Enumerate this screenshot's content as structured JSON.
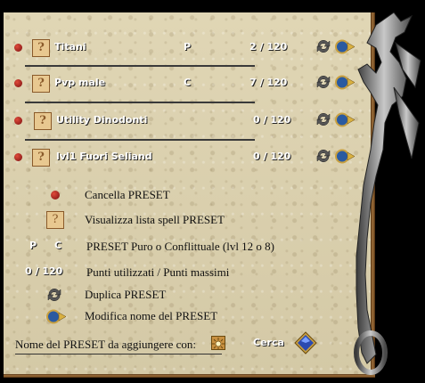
{
  "presets": [
    {
      "name": "Titani",
      "type": "P",
      "used": "2",
      "max": "120"
    },
    {
      "name": "Pvp male",
      "type": "C",
      "used": "7",
      "max": "120"
    },
    {
      "name": "Utility Dinodonti",
      "type": "",
      "used": "0",
      "max": "120"
    },
    {
      "name": "lvl1 Fuori Seliand",
      "type": "",
      "used": "0",
      "max": "120"
    }
  ],
  "legend": {
    "delete_label": "Cancella PRESET",
    "view_label": "Visualizza lista spell PRESET",
    "p_symbol": "P",
    "c_symbol": "C",
    "type_label": "PRESET Puro o Conflittuale (lvl 12 o 8)",
    "points_used": "0",
    "points_max": "120",
    "points_label": "Punti utilizzati / Punti massimi",
    "duplicate_label": "Duplica PRESET",
    "rename_label": "Modifica nome del PRESET"
  },
  "footer": {
    "add_label": "Nome del PRESET da aggiungere con:",
    "search_label": "Cerca"
  },
  "colors": {
    "parchment": "#d9cfae",
    "red_gem": "#b02020",
    "blue_gem": "#2a4ab0"
  }
}
